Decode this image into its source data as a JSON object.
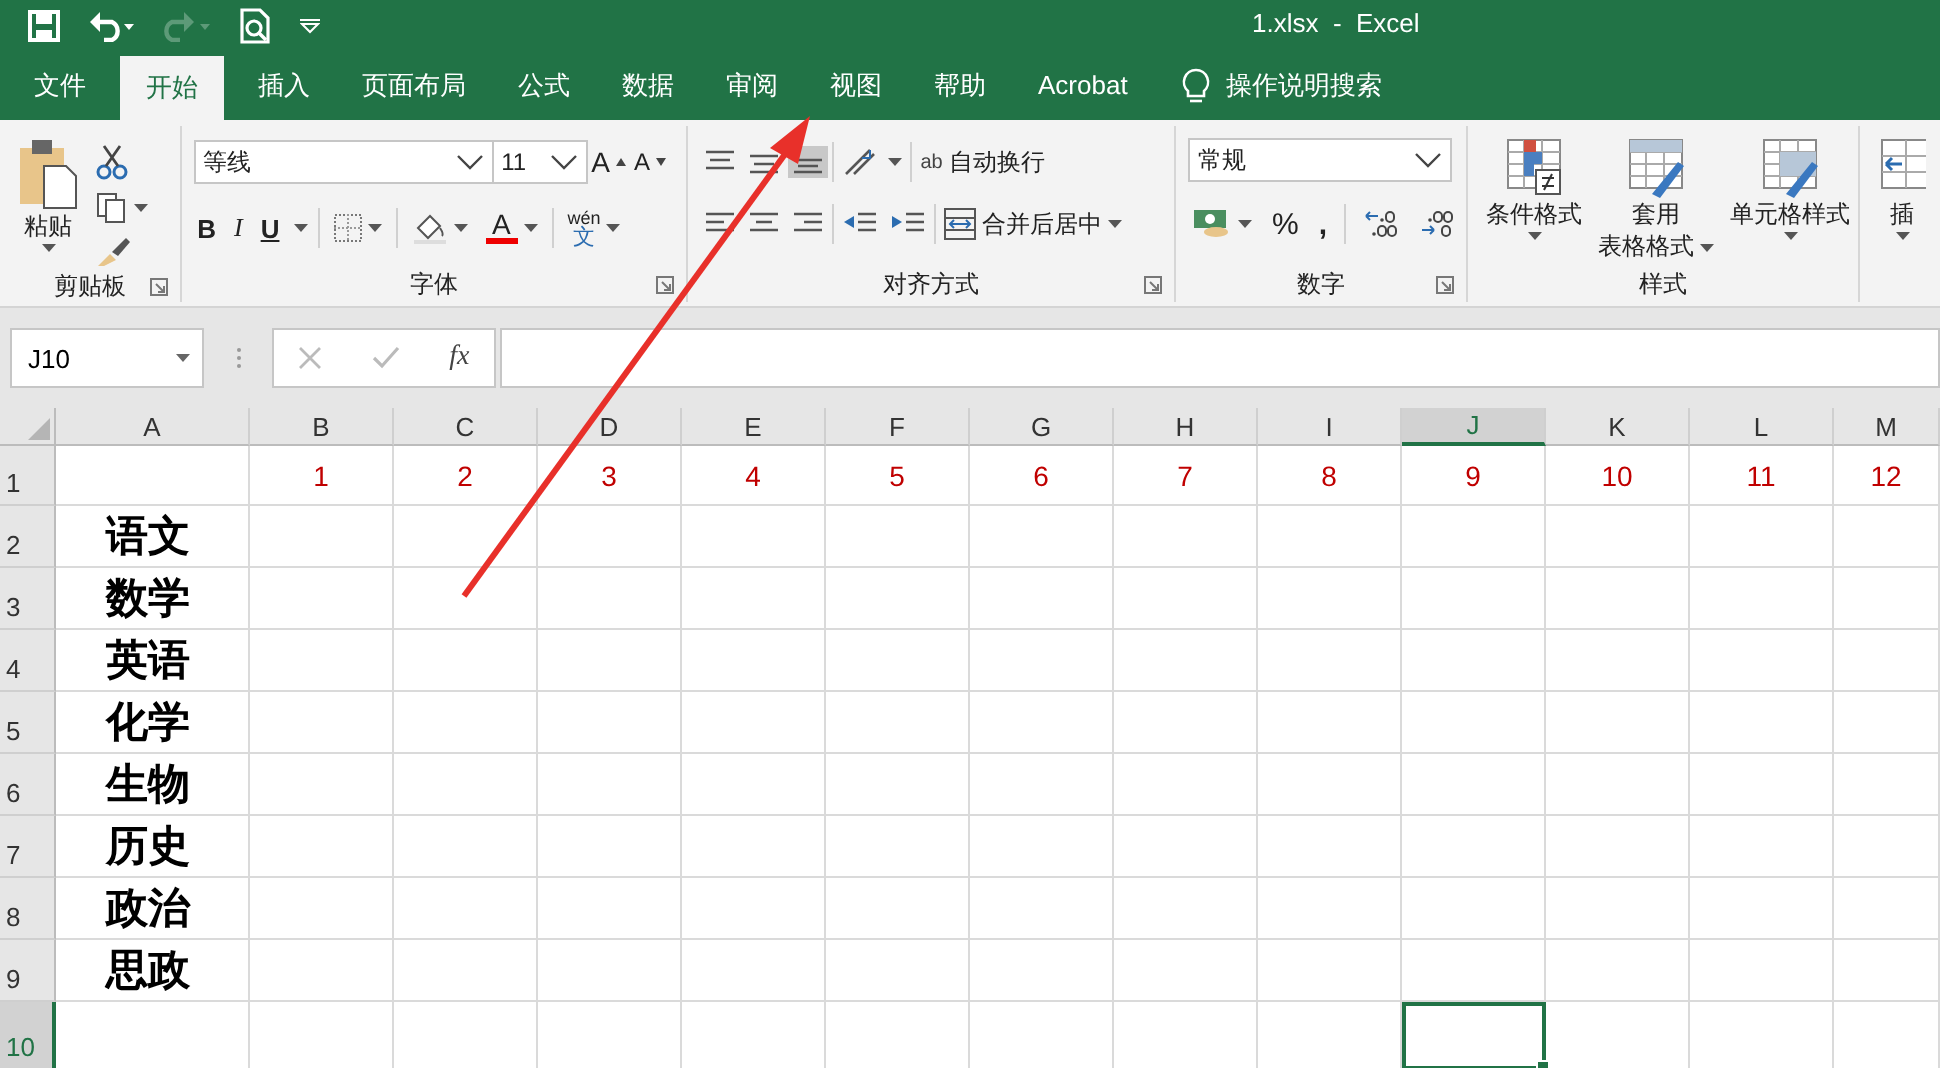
{
  "window": {
    "title": "1.xlsx  -  Excel"
  },
  "tabs": [
    {
      "label": "文件",
      "selected": false
    },
    {
      "label": "开始",
      "selected": true
    },
    {
      "label": "插入",
      "selected": false
    },
    {
      "label": "页面布局",
      "selected": false
    },
    {
      "label": "公式",
      "selected": false
    },
    {
      "label": "数据",
      "selected": false
    },
    {
      "label": "审阅",
      "selected": false
    },
    {
      "label": "视图",
      "selected": false
    },
    {
      "label": "帮助",
      "selected": false
    },
    {
      "label": "Acrobat",
      "selected": false
    }
  ],
  "tell_me": "操作说明搜索",
  "ribbon": {
    "clipboard": {
      "paste": "粘贴",
      "label": "剪贴板"
    },
    "font": {
      "name": "等线",
      "size": "11",
      "grow": "A",
      "shrink": "A",
      "bold": "B",
      "italic": "I",
      "underline": "U",
      "font_color": "A",
      "phonetic_top": "wén",
      "phonetic_bottom": "文",
      "label": "字体"
    },
    "alignment": {
      "wrap_icon": "ab",
      "wrap": "自动换行",
      "merge": "合并后居中",
      "label": "对齐方式"
    },
    "number": {
      "format": "常规",
      "percent": "%",
      "comma": ",",
      "label": "数字"
    },
    "styles": {
      "conditional": "条件格式",
      "table_format_line1": "套用",
      "table_format_line2": "表格格式",
      "cell_styles": "单元格样式",
      "label": "样式"
    },
    "cells": {
      "insert": "插"
    }
  },
  "name_box": "J10",
  "formula_bar": {
    "fx": "fx"
  },
  "sheet": {
    "columns": [
      {
        "label": "A",
        "selected": false
      },
      {
        "label": "B",
        "selected": false
      },
      {
        "label": "C",
        "selected": false
      },
      {
        "label": "D",
        "selected": false
      },
      {
        "label": "E",
        "selected": false
      },
      {
        "label": "F",
        "selected": false
      },
      {
        "label": "G",
        "selected": false
      },
      {
        "label": "H",
        "selected": false
      },
      {
        "label": "I",
        "selected": false
      },
      {
        "label": "J",
        "selected": true
      },
      {
        "label": "K",
        "selected": false
      },
      {
        "label": "L",
        "selected": false
      },
      {
        "label": "M",
        "selected": false
      }
    ],
    "rows": [
      {
        "header": "1",
        "selected": false,
        "cells": [
          {
            "selected": false
          },
          {
            "text": "1",
            "selected": false
          },
          {
            "text": "2",
            "selected": false
          },
          {
            "text": "3",
            "selected": false
          },
          {
            "text": "4",
            "selected": false
          },
          {
            "text": "5",
            "selected": false
          },
          {
            "text": "6",
            "selected": false
          },
          {
            "text": "7",
            "selected": false
          },
          {
            "text": "8",
            "selected": false
          },
          {
            "text": "9",
            "selected": false
          },
          {
            "text": "10",
            "selected": false
          },
          {
            "text": "11",
            "selected": false
          },
          {
            "text": "12",
            "selected": false
          }
        ]
      },
      {
        "header": "2",
        "selected": false,
        "cells": [
          {
            "text": "语文",
            "selected": false
          }
        ]
      },
      {
        "header": "3",
        "selected": false,
        "cells": [
          {
            "text": "数学",
            "selected": false
          }
        ]
      },
      {
        "header": "4",
        "selected": false,
        "cells": [
          {
            "text": "英语",
            "selected": false
          }
        ]
      },
      {
        "header": "5",
        "selected": false,
        "cells": [
          {
            "text": "化学",
            "selected": false
          }
        ]
      },
      {
        "header": "6",
        "selected": false,
        "cells": [
          {
            "text": "生物",
            "selected": false
          }
        ]
      },
      {
        "header": "7",
        "selected": false,
        "cells": [
          {
            "text": "历史",
            "selected": false
          }
        ]
      },
      {
        "header": "8",
        "selected": false,
        "cells": [
          {
            "text": "政治",
            "selected": false
          }
        ]
      },
      {
        "header": "9",
        "selected": false,
        "cells": [
          {
            "text": "思政",
            "selected": false
          }
        ]
      },
      {
        "header": "10",
        "selected": true,
        "cells": [
          {
            "selected": false
          },
          {
            "selected": false
          },
          {
            "selected": false
          },
          {
            "selected": false
          },
          {
            "selected": false
          },
          {
            "selected": false
          },
          {
            "selected": false
          },
          {
            "selected": false
          },
          {
            "selected": false
          },
          {
            "selected": true
          },
          {
            "selected": false
          },
          {
            "selected": false
          },
          {
            "selected": false
          }
        ]
      }
    ]
  }
}
